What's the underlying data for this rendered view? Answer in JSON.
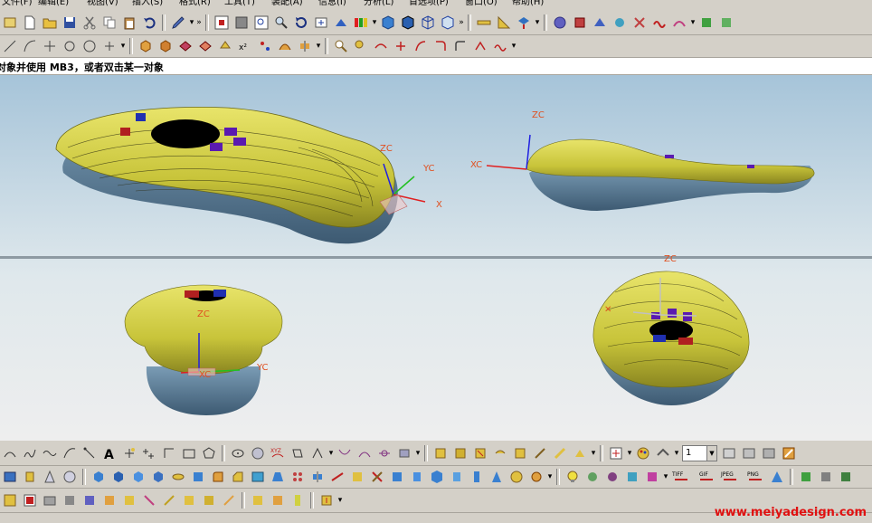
{
  "menu": [
    "文件(F)",
    "编辑(E)",
    "视图(V)",
    "插入(S)",
    "格式(R)",
    "工具(T)",
    "装配(A)",
    "信息(I)",
    "分析(L)",
    "首选项(P)",
    "窗口(O)",
    "帮助(H)"
  ],
  "cue_line": "对象并使用 MB3，或者双击某一对象",
  "views": {
    "iso": {
      "zc": "ZC",
      "yc": "YC",
      "xc": "X"
    },
    "right": {
      "zc": "ZC",
      "xc": "XC"
    },
    "front": {
      "zc": "ZC",
      "xc": "XC",
      "yc": "YC"
    },
    "top": {
      "zc": "ZC"
    }
  },
  "layer_field": "1",
  "export_labels": [
    "TIFF",
    "GIF",
    "JPEG",
    "PNG"
  ],
  "watermark": "www.meiyadesign.com",
  "colors": {
    "shell_yellow": "#c8c43a",
    "shell_blue": "#5c7f99",
    "accent_purple": "#5a1ab0",
    "accent_red": "#c01818",
    "axis_red": "#e02020",
    "axis_green": "#20c020",
    "axis_blue": "#2020e0",
    "label_orange": "#e05020",
    "watermark_red": "#e01010"
  }
}
